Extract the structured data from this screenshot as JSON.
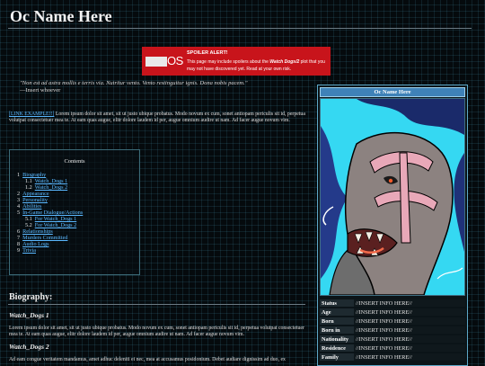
{
  "page": {
    "title": "Oc Name Here"
  },
  "spoiler": {
    "logo_text": "OS",
    "alert_title": "SPOILER ALERT!",
    "message_pre": "This page may include spoilers about the ",
    "message_game": "Watch Dogs/2",
    "message_post": " plot that you may not have discovered yet. Read at your own risk."
  },
  "quote": {
    "text": "\"Non est ad astra mollis e terris via. Nutritur vento. Vento restinguitur ignis. Dona nobis pacem.\"",
    "author": "—Insert whoever"
  },
  "intro": {
    "link": "[LINK EXAMPLE!!]",
    "text": " Lorem ipsum dolor sit amet, sit ut justo ubique probatus. Modo novum ex cum, sonet antiopam periculis sit id, perpetua volutpat consectetuer mea te. At eam quas augue, elitr dolore laudem id per, augue omnium audire ut nam. Ad facer augue novum vim."
  },
  "toc": {
    "heading": "Contents",
    "items": [
      {
        "num": "1",
        "label": "Biography",
        "sub": false
      },
      {
        "num": "1.1",
        "label": "Watch_Dogs 1",
        "sub": true
      },
      {
        "num": "1.2",
        "label": "Watch_Dogs 2",
        "sub": true
      },
      {
        "num": "2",
        "label": "Appearance",
        "sub": false
      },
      {
        "num": "3",
        "label": "Personality",
        "sub": false
      },
      {
        "num": "4",
        "label": "Abilities",
        "sub": false
      },
      {
        "num": "5",
        "label": "In-Game Dialogue/Actions",
        "sub": false
      },
      {
        "num": "5.1",
        "label": "For Watch_Dogs 1",
        "sub": true
      },
      {
        "num": "5.2",
        "label": "For Watch_Dogs 2",
        "sub": true
      },
      {
        "num": "6",
        "label": "Relationships",
        "sub": false
      },
      {
        "num": "7",
        "label": "Murders Committed",
        "sub": false
      },
      {
        "num": "8",
        "label": "Audio Logs",
        "sub": false
      },
      {
        "num": "9",
        "label": "Trivia",
        "sub": false
      }
    ]
  },
  "biography": {
    "heading": "Biography:",
    "section1_title": "Watch_Dogs 1",
    "section1_text": "Lorem ipsum dolor sit amet, sit ut justo ubique probatus. Modo novum ex cum, sonet antiopam periculis sit id, perpetua volutpat consectetuer mea te. At eam quas augue, elitr dolore laudem id per, augue omnium audire ut nam. Ad facer augue novum vim.",
    "section2_title": "Watch_Dogs 2",
    "section2_text": "Ad eam congue veritatem mandamus, amet adhuc deleniti ei nec, mea at accusamus posidonium. Debet audiare dignissim ad duo, ex"
  },
  "infobox": {
    "title": "Oc Name Here",
    "rows": [
      {
        "key": "Status",
        "value": "//INSERT INFO HERE//"
      },
      {
        "key": "Age",
        "value": "//INSERT INFO HERE//"
      },
      {
        "key": "Born",
        "value": "//INSERT INFO HERE//"
      },
      {
        "key": "Born in",
        "value": "//INSERT INFO HERE//"
      },
      {
        "key": "Nationality",
        "value": "//INSERT INFO HERE//"
      },
      {
        "key": "Residence",
        "value": "//INSERT INFO HERE//"
      },
      {
        "key": "Family",
        "value": "//INSERT INFO HERE//"
      }
    ]
  },
  "colors": {
    "background": "#050a0d",
    "grid": "#4696af",
    "link": "#5ab8ff",
    "spoiler_red": "#c8141b",
    "infobox_title": "#3f82b8",
    "art_cyan": "#35d8f2"
  }
}
